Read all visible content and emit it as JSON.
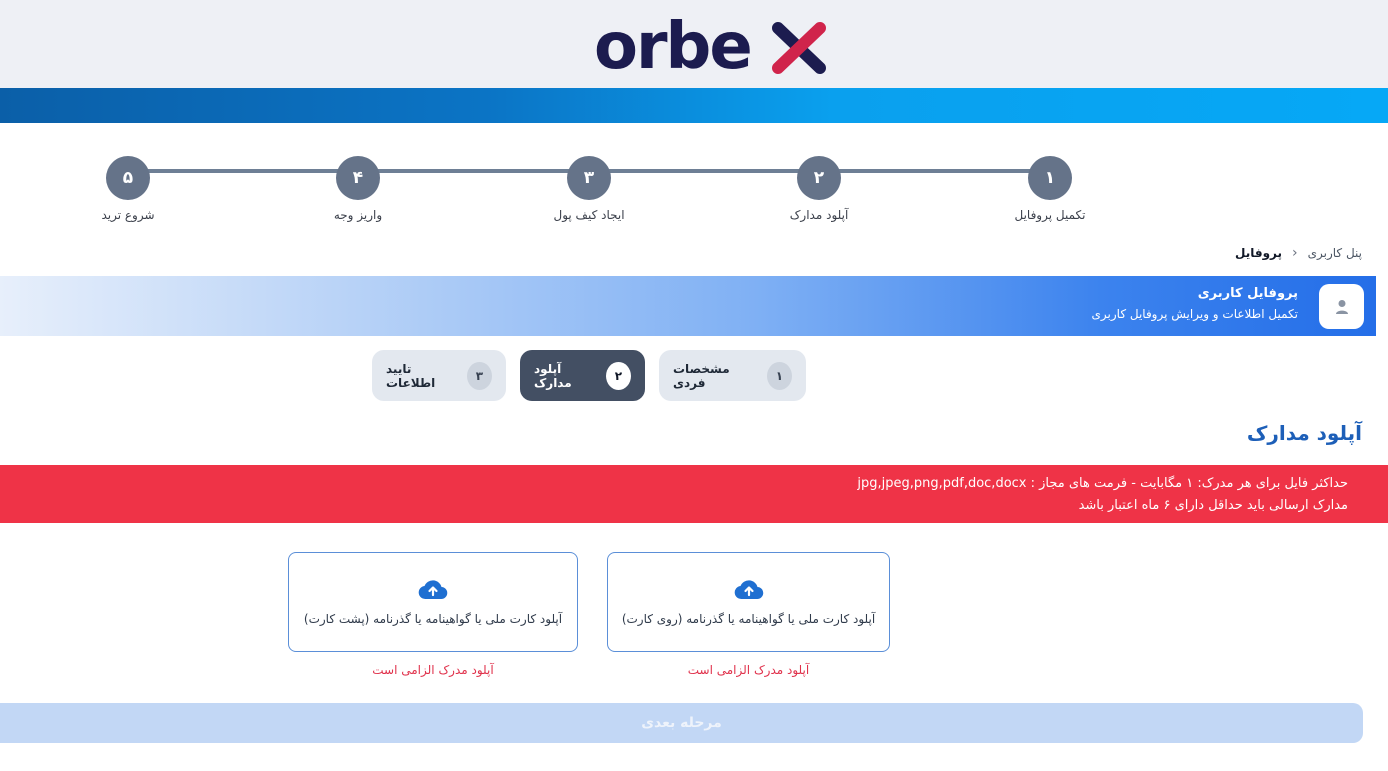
{
  "brand": {
    "logo_text": "orbex",
    "logo_accent": "#d0244b",
    "logo_color": "#1c1c4f"
  },
  "stepper": {
    "steps": [
      {
        "number": "۱",
        "label": "تکمیل پروفایل"
      },
      {
        "number": "۲",
        "label": "آپلود مدارک"
      },
      {
        "number": "۳",
        "label": "ایجاد کیف پول"
      },
      {
        "number": "۴",
        "label": "واریز وجه"
      },
      {
        "number": "۵",
        "label": "شروع ترید"
      }
    ]
  },
  "breadcrumb": {
    "root": "پنل کاربری",
    "separator": "›",
    "current": "پروفایل"
  },
  "banner": {
    "title": "پروفایل کاربری",
    "subtitle": "تکمیل اطلاعات و ویرایش پروفایل کاربری"
  },
  "tabs": [
    {
      "number": "۱",
      "label": "مشخصات فردی"
    },
    {
      "number": "۲",
      "label": "آپلود مدارک"
    },
    {
      "number": "۳",
      "label": "تایید اطلاعات"
    }
  ],
  "section_title": "آپلود مدارک",
  "alert": {
    "line1": "حداکثر فایل برای هر مدرک: ۱ مگابایت - فرمت های مجاز : jpg,jpeg,png,pdf,doc,docx",
    "line2": "مدارک ارسالی باید حداقل دارای ۶ ماه اعتبار باشد"
  },
  "uploads": {
    "front": {
      "label": "آپلود کارت ملی یا گواهینامه یا گذرنامه (روی کارت)",
      "error": "آپلود مدرک الزامی است"
    },
    "back": {
      "label": "آپلود کارت ملی یا گواهینامه یا گذرنامه (پشت کارت)",
      "error": "آپلود مدرک الزامی است"
    }
  },
  "next_button": "مرحله بعدی",
  "colors": {
    "accent": "#1d5fb8",
    "alert": "#ef3347",
    "step": "#657389",
    "active_tab": "#434f63"
  }
}
